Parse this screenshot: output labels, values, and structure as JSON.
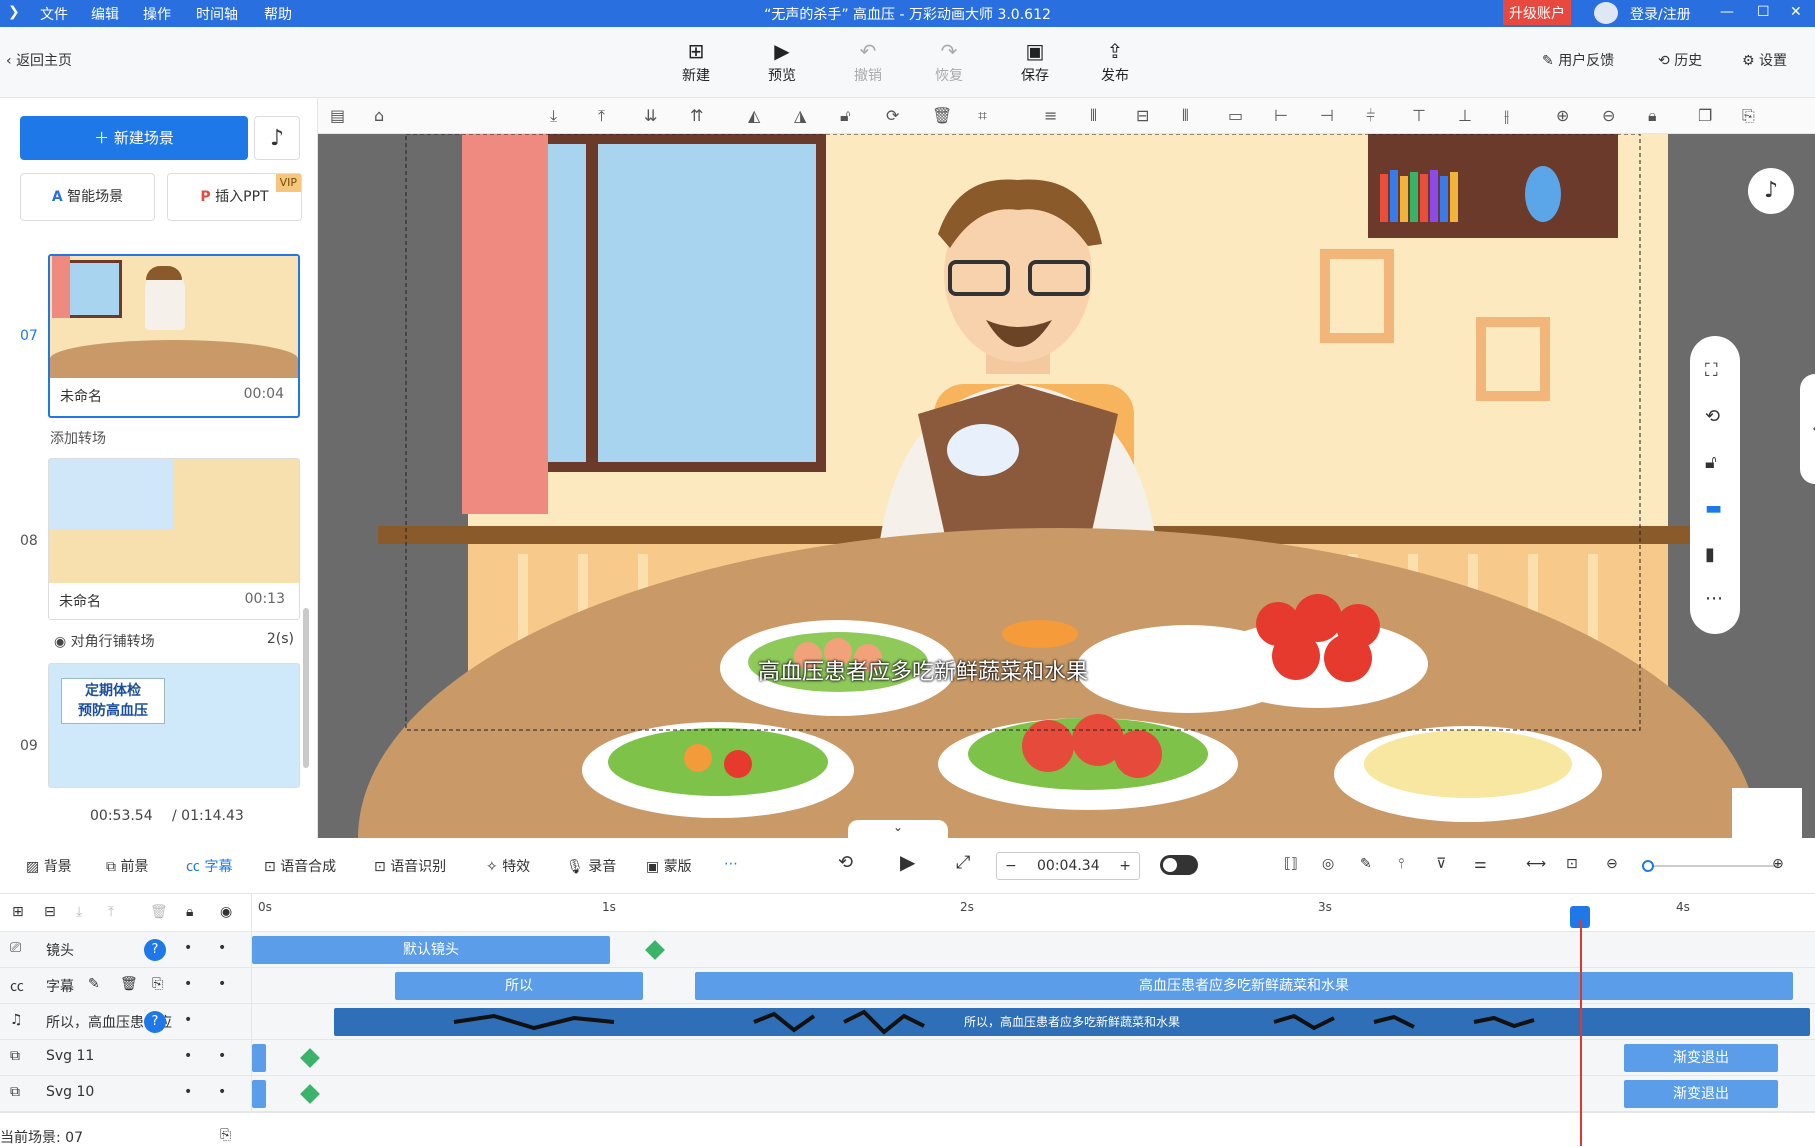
{
  "app": {
    "window_title": "“无声的杀手” 高血压 - 万彩动画大师 3.0.612",
    "menu": [
      "文件",
      "编辑",
      "操作",
      "时间轴",
      "帮助"
    ],
    "upgrade": "升级账户",
    "login": "登录/注册"
  },
  "toolbar": {
    "back": "返回主页",
    "buttons": [
      "新建",
      "预览",
      "撤销",
      "恢复",
      "保存",
      "发布"
    ],
    "right": [
      "用户反馈",
      "历史",
      "设置"
    ]
  },
  "left": {
    "new_scene": "新建场景",
    "smart_scene": "智能场景",
    "insert_ppt": "插入PPT",
    "vip": "VIP",
    "scenes": [
      {
        "num": "07",
        "name": "未命名",
        "duration": "00:04"
      },
      {
        "num": "08",
        "name": "未命名",
        "duration": "00:13"
      },
      {
        "num": "09",
        "name": "",
        "duration": ""
      }
    ],
    "add_transition": "添加转场",
    "transition_name": "对角行铺转场",
    "transition_dur": "2(s)",
    "scene09_text_line1": "定期体检",
    "scene09_text_line2": "预防高血压",
    "time_current": "00:53.54",
    "time_total": "/ 01:14.43"
  },
  "canvas": {
    "subtitle": "高血压患者应多吃新鲜蔬菜和水果",
    "camera_label": "默认镜头"
  },
  "timeline_tools": {
    "items": [
      "背景",
      "前景",
      "字幕",
      "语音合成",
      "语音识别",
      "特效",
      "录音",
      "蒙版"
    ],
    "time": "00:04.34"
  },
  "timeline": {
    "ticks": [
      "0s",
      "1s",
      "2s",
      "3s",
      "4s"
    ],
    "tracks": [
      {
        "name": "镜头",
        "clips": [
          "默认镜头"
        ]
      },
      {
        "name": "字幕",
        "clips": [
          "所以",
          "高血压患者应多吃新鲜蔬菜和水果"
        ]
      },
      {
        "name": "所以，高血压患者应",
        "clips": [
          "所以，高血压患者应多吃新鲜蔬菜和水果"
        ]
      },
      {
        "name": "Svg 11",
        "clips": [
          "渐变退出"
        ]
      },
      {
        "name": "Svg 10",
        "clips": [
          "渐变退出"
        ]
      }
    ],
    "current_scene": "当前场景: 07"
  }
}
